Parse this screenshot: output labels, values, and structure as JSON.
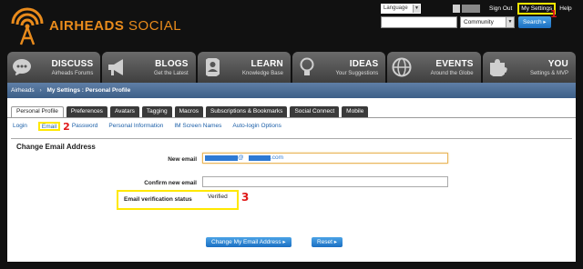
{
  "header": {
    "brand": "AIRHEADS",
    "brand_suffix": "SOCIAL",
    "language_label": "Language",
    "sign_out": "Sign Out",
    "my_settings": "My Settings",
    "help": "Help",
    "search_scope": "Community",
    "search_button": "Search ▸"
  },
  "annotations": {
    "one": "1",
    "two": "2",
    "three": "3"
  },
  "nav": [
    {
      "title": "DISCUSS",
      "sub": "Airheads Forums"
    },
    {
      "title": "BLOGS",
      "sub": "Get the Latest"
    },
    {
      "title": "LEARN",
      "sub": "Knowledge Base"
    },
    {
      "title": "IDEAS",
      "sub": "Your Suggestions"
    },
    {
      "title": "EVENTS",
      "sub": "Around the Globe"
    },
    {
      "title": "YOU",
      "sub": "Settings & MVP"
    }
  ],
  "breadcrumb": {
    "root": "Airheads",
    "separator": "›",
    "current": "My Settings : Personal Profile"
  },
  "tabs": [
    "Personal Profile",
    "Preferences",
    "Avatars",
    "Tagging",
    "Macros",
    "Subscriptions & Bookmarks",
    "Social Connect",
    "Mobile"
  ],
  "subtabs": [
    "Login",
    "Email",
    "Password",
    "Personal Information",
    "IM Screen Names",
    "Auto-login Options"
  ],
  "form": {
    "section_title": "Change Email Address",
    "new_email_label": "New email",
    "new_email_value_part": "@",
    "new_email_value_domain": ".com",
    "confirm_email_label": "Confirm new email",
    "status_label": "Email verification status",
    "status_value": "Verified",
    "change_button": "Change My Email Address ▸",
    "reset_button": "Reset ▸"
  },
  "colors": {
    "brand_orange": "#e98b1c",
    "highlight_yellow": "#ffe800",
    "annotation_red": "#e01818",
    "link_blue": "#1b5fa8",
    "button_blue": "#1c6fc2"
  }
}
